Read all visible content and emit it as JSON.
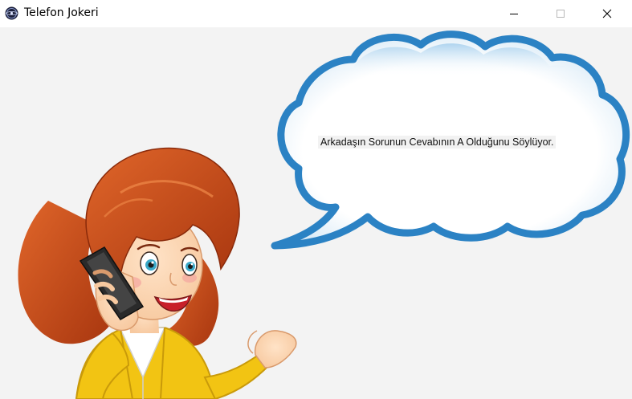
{
  "window": {
    "title": "Telefon Jokeri",
    "icon": "millionaire-logo-icon",
    "controls": [
      "minimize-icon",
      "maximize-icon",
      "close-icon"
    ]
  },
  "main": {
    "message": "Arkadaşın Sorunun Cevabının A Olduğunu Söylüyor.",
    "illustration": "woman-on-phone-with-speech-bubble"
  },
  "colors": {
    "bubble_outline": "#2b82c4",
    "hair": "#c2461a",
    "jacket": "#f2c413",
    "background": "#f3f3f3"
  }
}
